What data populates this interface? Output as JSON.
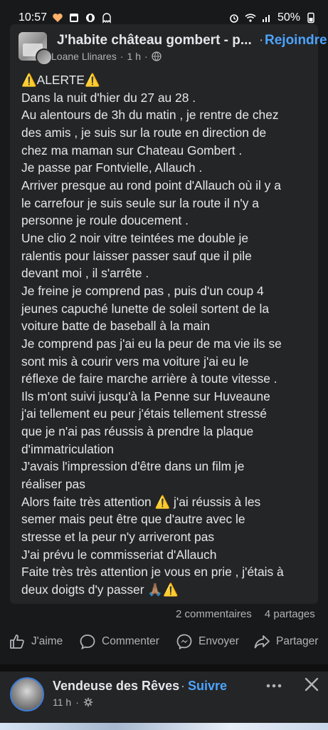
{
  "status_bar": {
    "time": "10:57",
    "battery_percent": "50%"
  },
  "post": {
    "group_name": "J'habite château gombert - p...",
    "separator": "·",
    "join_label": "Rejoindre",
    "author": "Loane Llinares",
    "time": "1 h",
    "body_lines": [
      "⚠️ALERTE⚠️",
      "Dans la nuit d'hier du 27 au 28 .",
      "Au alentours de 3h du matin , je rentre de chez",
      "des amis , je suis sur la route en direction de",
      "chez ma maman sur Chateau Gombert .",
      "Je passe par Fontvielle, Allauch .",
      "Arriver presque au rond point d'Allauch où il y a",
      "le carrefour je suis seule sur la route il n'y a",
      "personne je roule doucement .",
      "Une clio 2 noir vitre teintées me double je",
      "ralentis pour laisser passer sauf que il pile",
      "devant moi , il s'arrête .",
      "Je freine je comprend pas , puis d'un coup 4",
      "jeunes capuché lunette de soleil sortent de la",
      "voiture batte de baseball à la main",
      "Je comprend pas j'ai eu la peur de ma vie ils se",
      "sont mis à courir vers ma voiture j'ai eu le",
      "réflexe de faire marche arrière à toute vitesse .",
      "Ils m'ont suivi jusqu'à la Penne sur Huveaune",
      "j'ai tellement eu peur j'étais tellement stressé",
      "que je n'ai pas réussis à prendre la plaque",
      "d'immatriculation",
      "J'avais l'impression d'être dans un film je",
      "réaliser pas",
      "Alors faite très attention ⚠️ j'ai réussis à les",
      "semer mais peut être que d'autre avec le",
      "stresse et la peur n'y arriveront pas",
      "J'ai prévu le commisseriat d'Allauch",
      "Faite très très attention je vous en prie , j'étais à",
      "deux doigts d'y passer 🙏🏽⚠️"
    ],
    "comments_count": "2 commentaires",
    "shares_count": "4 partages",
    "actions": {
      "like": "J'aime",
      "comment": "Commenter",
      "send": "Envoyer",
      "share": "Partager"
    }
  },
  "next_post": {
    "name": "Vendeuse des Rêves",
    "separator": "·",
    "follow_label": "Suivre",
    "time": "11 h",
    "icons": [
      "more-icon",
      "close-icon",
      "settings-icon"
    ]
  },
  "colors": {
    "background": "#18191a",
    "card": "#242526",
    "text": "#e4e6eb",
    "muted": "#b0b3b8",
    "link": "#4da3ff"
  }
}
